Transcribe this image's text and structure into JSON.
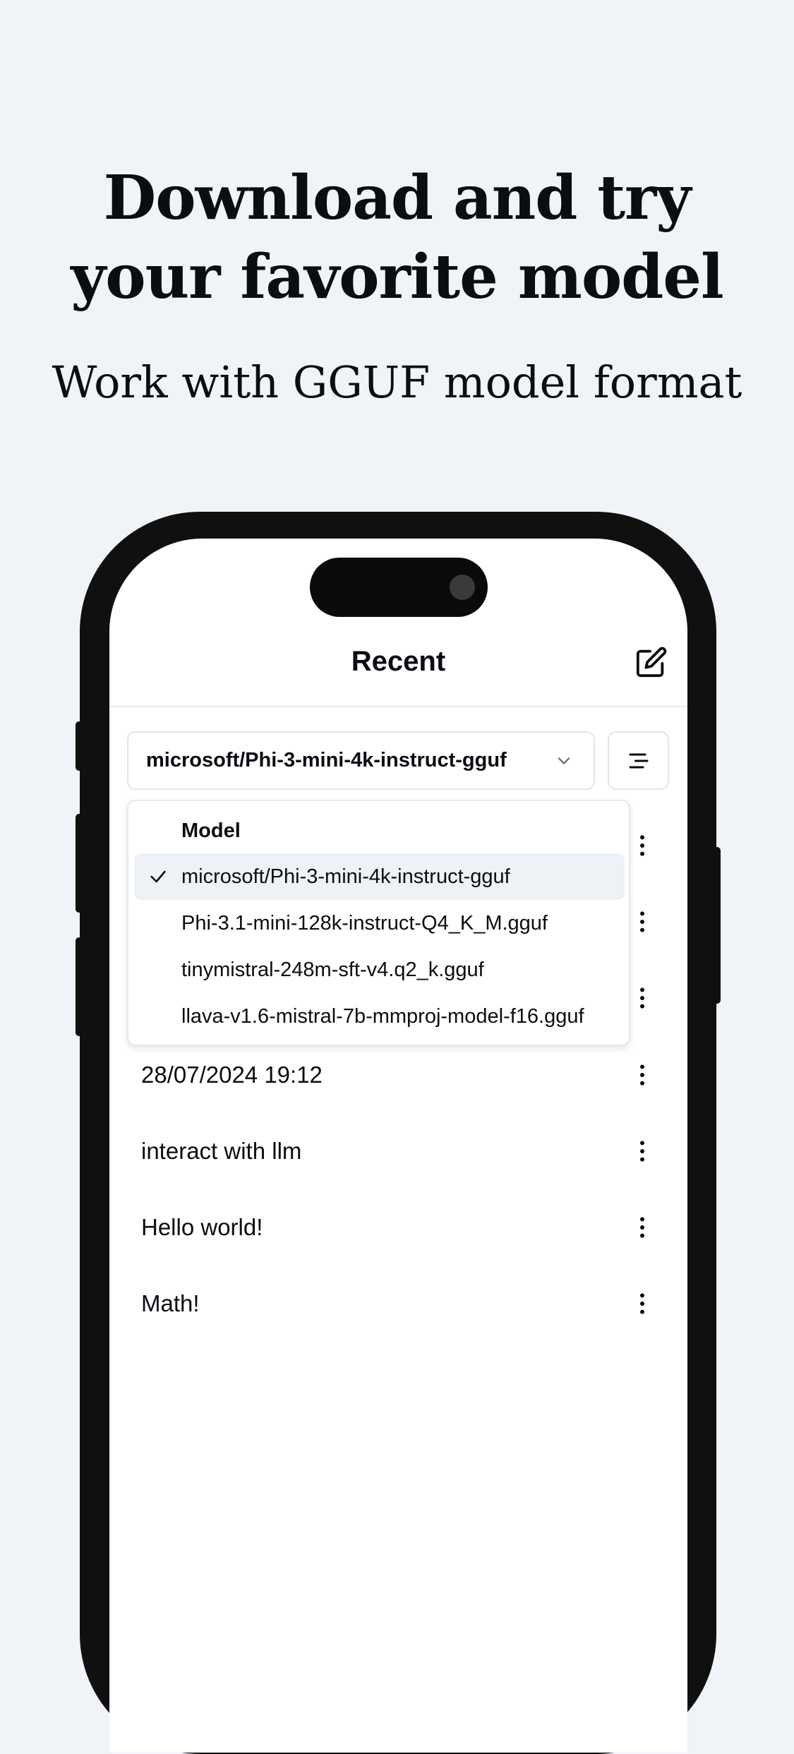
{
  "hero": {
    "title_line1": "Download and try",
    "title_line2": "your favorite model",
    "subtitle": "Work with GGUF model format"
  },
  "app": {
    "header": {
      "title": "Recent"
    },
    "model_select": {
      "value": "microsoft/Phi-3-mini-4k-instruct-gguf"
    },
    "dropdown": {
      "label": "Model",
      "options": [
        {
          "label": "microsoft/Phi-3-mini-4k-instruct-gguf",
          "selected": true
        },
        {
          "label": "Phi-3.1-mini-128k-instruct-Q4_K_M.gguf",
          "selected": false
        },
        {
          "label": "tinymistral-248m-sft-v4.q2_k.gguf",
          "selected": false
        },
        {
          "label": "llava-v1.6-mistral-7b-mmproj-model-f16.gguf",
          "selected": false
        }
      ]
    },
    "chats": [
      {
        "title": "28/07/2024 19:12"
      },
      {
        "title": "interact with llm"
      },
      {
        "title": "Hello world!"
      },
      {
        "title": "Math!"
      }
    ]
  },
  "icons": {
    "edit": "edit-icon",
    "chevron": "chevron-down-icon",
    "sort": "sort-icon",
    "kebab": "more-vertical-icon",
    "check": "check-icon"
  }
}
